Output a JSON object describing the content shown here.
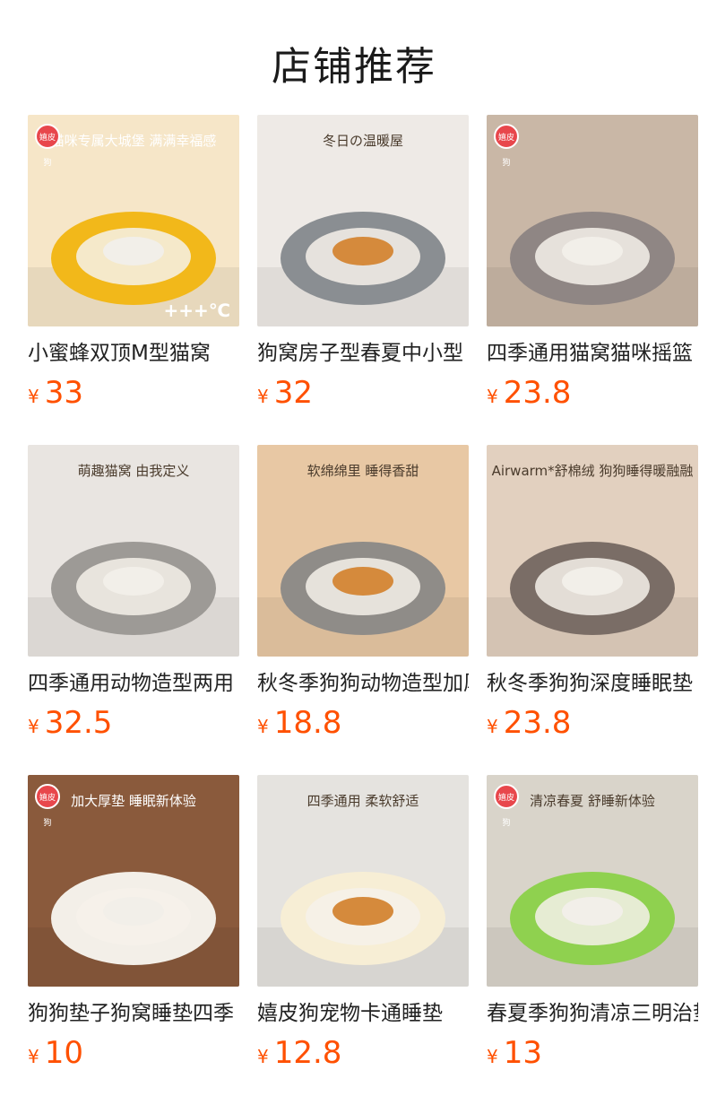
{
  "header": {
    "title": "店铺推荐"
  },
  "products": [
    {
      "name": "小蜜蜂双顶M型猫窝",
      "currency": "¥",
      "price": "33",
      "image_caption": "猫咪专属大城堡 满满幸福感",
      "image_badge": "嬉皮狗",
      "image_note": "+++℃",
      "bg": "#f6e6c8",
      "accent": "#f2b81a"
    },
    {
      "name": "狗窝房子型春夏中小型",
      "currency": "¥",
      "price": "32",
      "image_caption": "冬日の温暖屋",
      "image_badge": "",
      "image_note": "",
      "bg": "#eeeae6",
      "accent": "#8a8e92"
    },
    {
      "name": "四季通用猫窝猫咪摇篮",
      "currency": "¥",
      "price": "23.8",
      "image_caption": "",
      "image_badge": "嬉皮狗",
      "image_note": "",
      "bg": "#c9b7a6",
      "accent": "#8f8684"
    },
    {
      "name": "四季通用动物造型两用",
      "currency": "¥",
      "price": "32.5",
      "image_caption": "萌趣猫窝 由我定义",
      "image_badge": "",
      "image_note": "",
      "bg": "#e9e5e1",
      "accent": "#9d9a96"
    },
    {
      "name": "秋冬季狗狗动物造型加厚",
      "currency": "¥",
      "price": "18.8",
      "image_caption": "软绵绵里 睡得香甜",
      "image_badge": "",
      "image_note": "",
      "bg": "#e8c8a4",
      "accent": "#8f8c88"
    },
    {
      "name": "秋冬季狗狗深度睡眠垫",
      "currency": "¥",
      "price": "23.8",
      "image_caption": "Airwarm*舒棉绒 狗狗睡得暖融融",
      "image_badge": "",
      "image_note": "",
      "bg": "#e2d0bf",
      "accent": "#7a6d66"
    },
    {
      "name": "狗狗垫子狗窝睡垫四季",
      "currency": "¥",
      "price": "10",
      "image_caption": "加大厚垫 睡眠新体验",
      "image_badge": "嬉皮狗",
      "image_note": "",
      "bg": "#8a5a3c",
      "accent": "#f3efe8"
    },
    {
      "name": "嬉皮狗宠物卡通睡垫",
      "currency": "¥",
      "price": "12.8",
      "image_caption": "四季通用 柔软舒适",
      "image_badge": "",
      "image_note": "",
      "bg": "#e5e3df",
      "accent": "#f7eed5"
    },
    {
      "name": "春夏季狗狗清凉三明治垫",
      "currency": "¥",
      "price": "13",
      "image_caption": "清凉春夏 舒睡新体验",
      "image_badge": "嬉皮狗",
      "image_note": "",
      "bg": "#d9d4ca",
      "accent": "#8fd14f"
    }
  ]
}
